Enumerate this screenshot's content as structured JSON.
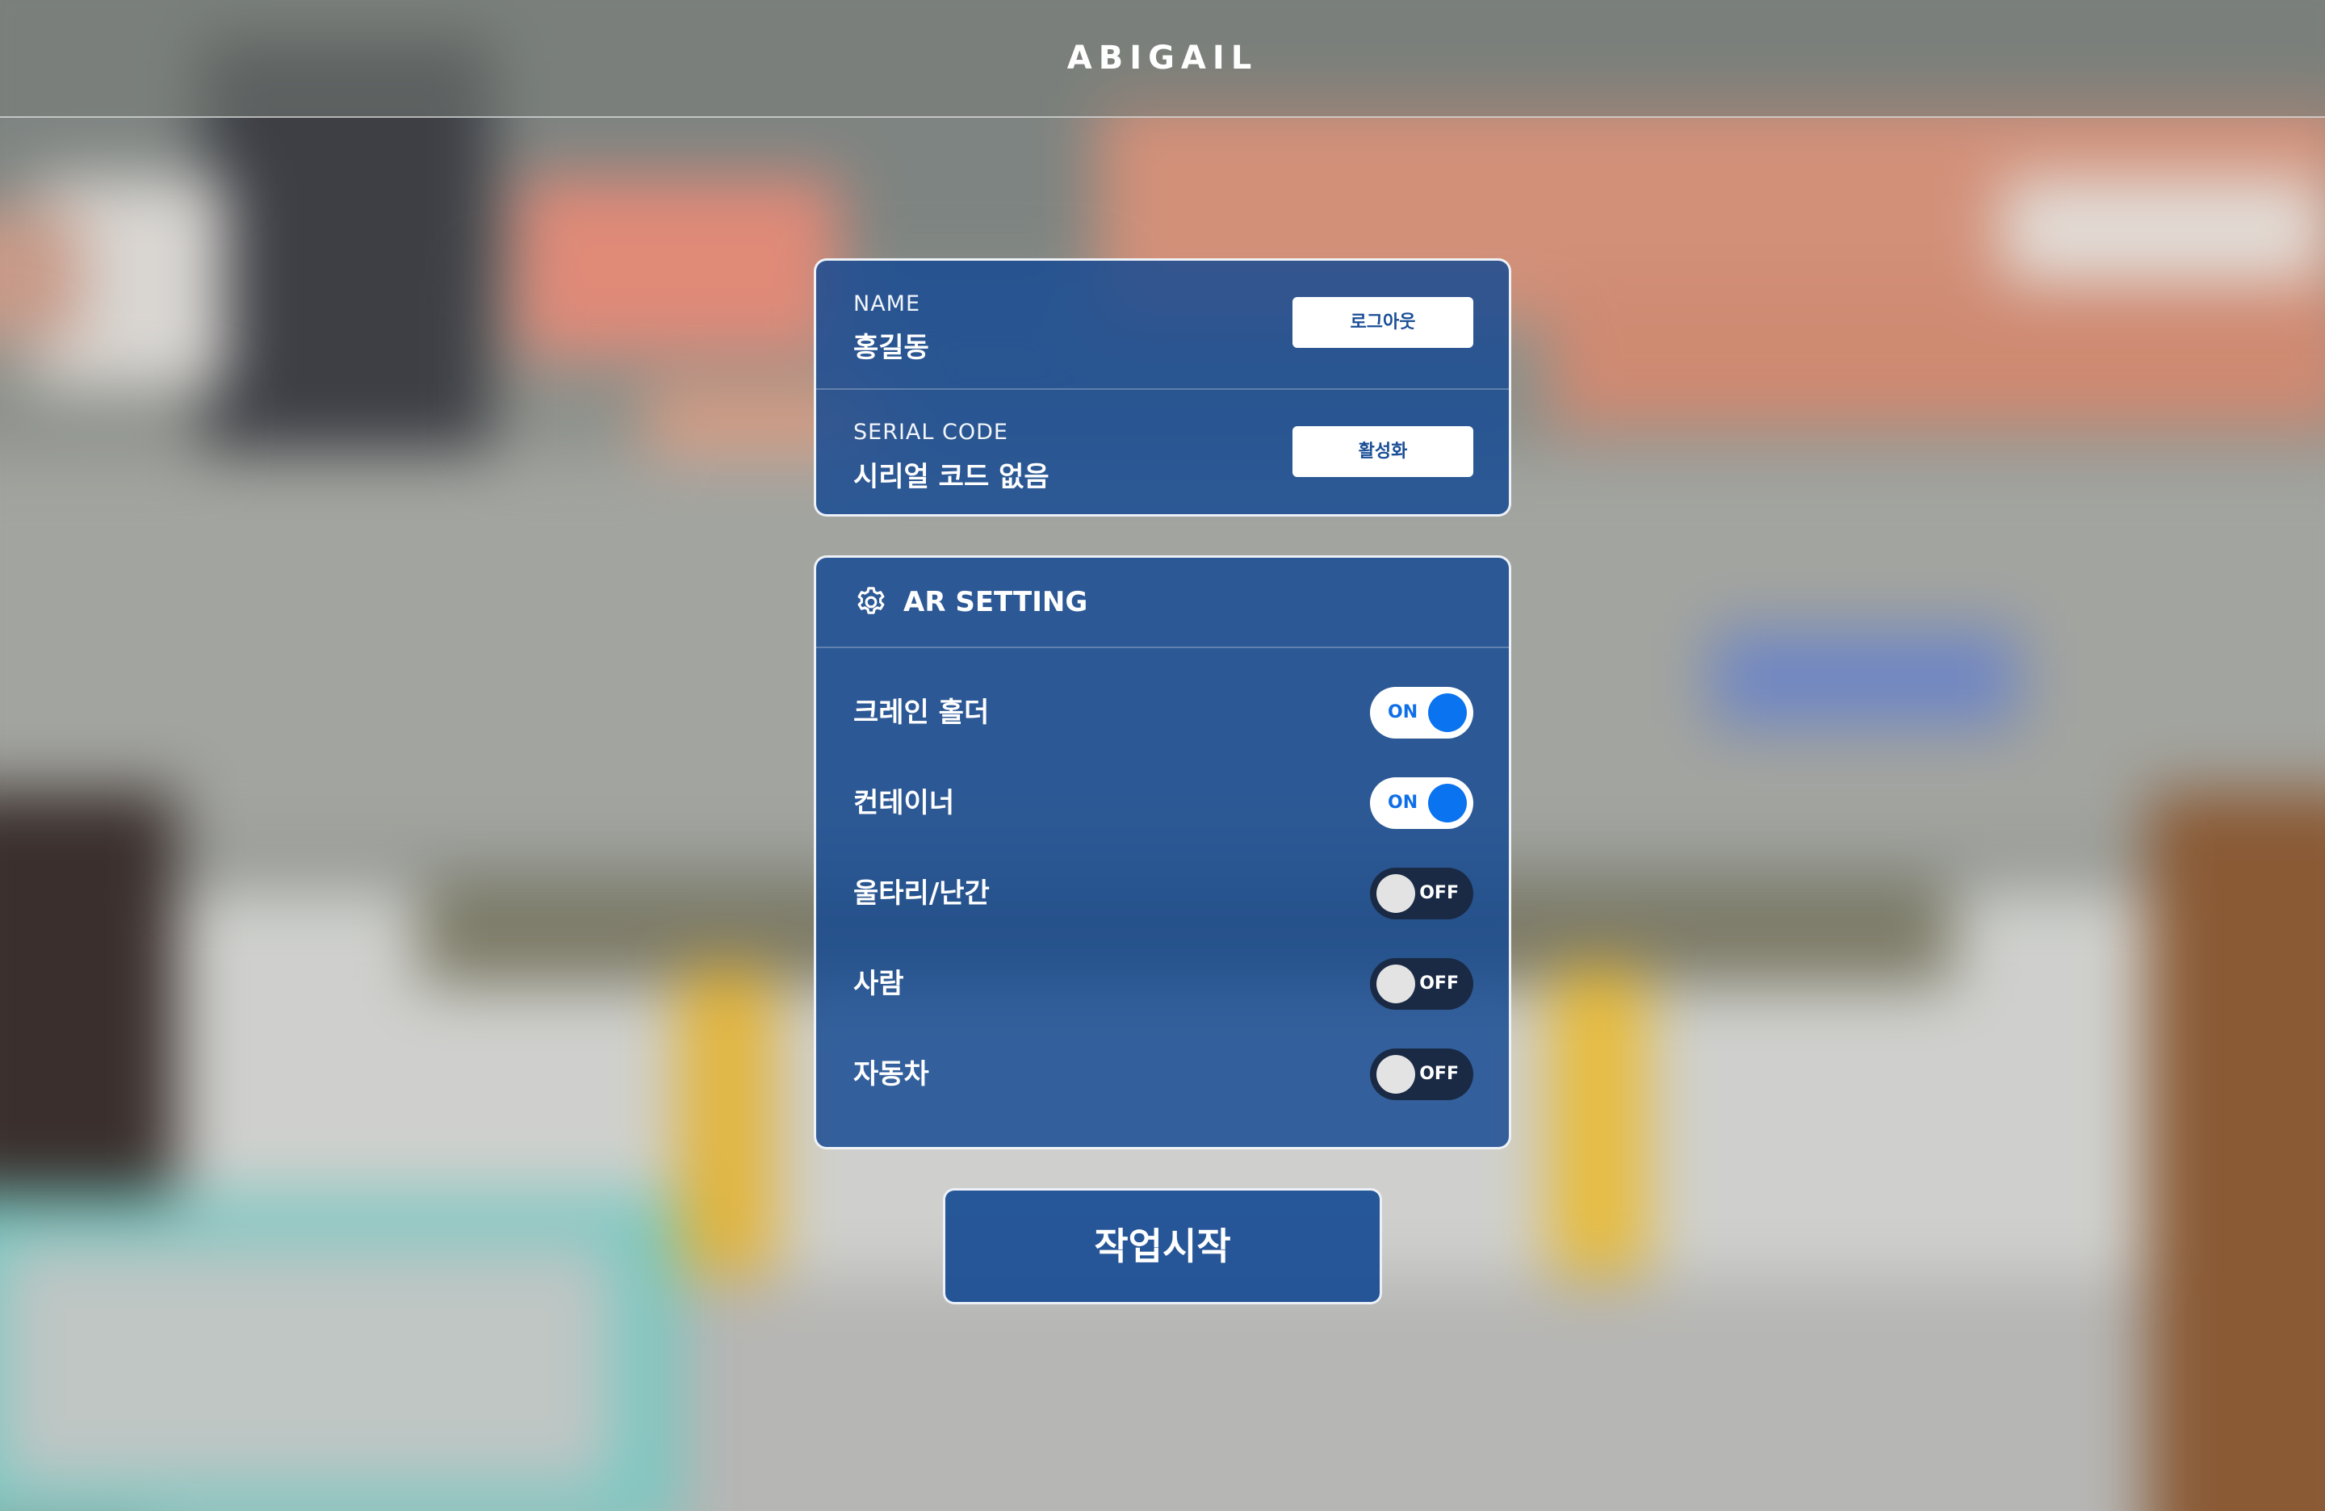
{
  "header": {
    "title": "ABIGAIL"
  },
  "account": {
    "name_label": "NAME",
    "name_value": "홍길동",
    "logout_button": "로그아웃",
    "serial_label": "SERIAL CODE",
    "serial_value": "시리얼 코드 없음",
    "activate_button": "활성화"
  },
  "ar_setting": {
    "title": "AR SETTING",
    "icon": "gear-icon",
    "items": [
      {
        "label": "크레인 홀더",
        "state": "ON",
        "enabled": true
      },
      {
        "label": "컨테이너",
        "state": "ON",
        "enabled": true
      },
      {
        "label": "울타리/난간",
        "state": "OFF",
        "enabled": false
      },
      {
        "label": "사람",
        "state": "OFF",
        "enabled": false
      },
      {
        "label": "자동차",
        "state": "OFF",
        "enabled": false
      }
    ]
  },
  "start_button": "작업시작",
  "colors": {
    "panel_blue": "#164a92",
    "toggle_on_knob": "#0a73f0",
    "toggle_off_track": "#1a2a45",
    "button_text_blue": "#1a4e96"
  }
}
